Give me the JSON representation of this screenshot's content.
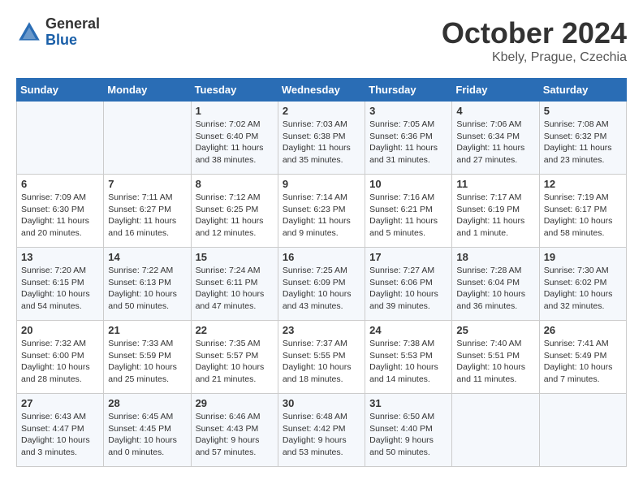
{
  "header": {
    "logo_general": "General",
    "logo_blue": "Blue",
    "month_title": "October 2024",
    "location": "Kbely, Prague, Czechia"
  },
  "days_of_week": [
    "Sunday",
    "Monday",
    "Tuesday",
    "Wednesday",
    "Thursday",
    "Friday",
    "Saturday"
  ],
  "weeks": [
    [
      {
        "day": "",
        "info": ""
      },
      {
        "day": "",
        "info": ""
      },
      {
        "day": "1",
        "info": "Sunrise: 7:02 AM\nSunset: 6:40 PM\nDaylight: 11 hours and 38 minutes."
      },
      {
        "day": "2",
        "info": "Sunrise: 7:03 AM\nSunset: 6:38 PM\nDaylight: 11 hours and 35 minutes."
      },
      {
        "day": "3",
        "info": "Sunrise: 7:05 AM\nSunset: 6:36 PM\nDaylight: 11 hours and 31 minutes."
      },
      {
        "day": "4",
        "info": "Sunrise: 7:06 AM\nSunset: 6:34 PM\nDaylight: 11 hours and 27 minutes."
      },
      {
        "day": "5",
        "info": "Sunrise: 7:08 AM\nSunset: 6:32 PM\nDaylight: 11 hours and 23 minutes."
      }
    ],
    [
      {
        "day": "6",
        "info": "Sunrise: 7:09 AM\nSunset: 6:30 PM\nDaylight: 11 hours and 20 minutes."
      },
      {
        "day": "7",
        "info": "Sunrise: 7:11 AM\nSunset: 6:27 PM\nDaylight: 11 hours and 16 minutes."
      },
      {
        "day": "8",
        "info": "Sunrise: 7:12 AM\nSunset: 6:25 PM\nDaylight: 11 hours and 12 minutes."
      },
      {
        "day": "9",
        "info": "Sunrise: 7:14 AM\nSunset: 6:23 PM\nDaylight: 11 hours and 9 minutes."
      },
      {
        "day": "10",
        "info": "Sunrise: 7:16 AM\nSunset: 6:21 PM\nDaylight: 11 hours and 5 minutes."
      },
      {
        "day": "11",
        "info": "Sunrise: 7:17 AM\nSunset: 6:19 PM\nDaylight: 11 hours and 1 minute."
      },
      {
        "day": "12",
        "info": "Sunrise: 7:19 AM\nSunset: 6:17 PM\nDaylight: 10 hours and 58 minutes."
      }
    ],
    [
      {
        "day": "13",
        "info": "Sunrise: 7:20 AM\nSunset: 6:15 PM\nDaylight: 10 hours and 54 minutes."
      },
      {
        "day": "14",
        "info": "Sunrise: 7:22 AM\nSunset: 6:13 PM\nDaylight: 10 hours and 50 minutes."
      },
      {
        "day": "15",
        "info": "Sunrise: 7:24 AM\nSunset: 6:11 PM\nDaylight: 10 hours and 47 minutes."
      },
      {
        "day": "16",
        "info": "Sunrise: 7:25 AM\nSunset: 6:09 PM\nDaylight: 10 hours and 43 minutes."
      },
      {
        "day": "17",
        "info": "Sunrise: 7:27 AM\nSunset: 6:06 PM\nDaylight: 10 hours and 39 minutes."
      },
      {
        "day": "18",
        "info": "Sunrise: 7:28 AM\nSunset: 6:04 PM\nDaylight: 10 hours and 36 minutes."
      },
      {
        "day": "19",
        "info": "Sunrise: 7:30 AM\nSunset: 6:02 PM\nDaylight: 10 hours and 32 minutes."
      }
    ],
    [
      {
        "day": "20",
        "info": "Sunrise: 7:32 AM\nSunset: 6:00 PM\nDaylight: 10 hours and 28 minutes."
      },
      {
        "day": "21",
        "info": "Sunrise: 7:33 AM\nSunset: 5:59 PM\nDaylight: 10 hours and 25 minutes."
      },
      {
        "day": "22",
        "info": "Sunrise: 7:35 AM\nSunset: 5:57 PM\nDaylight: 10 hours and 21 minutes."
      },
      {
        "day": "23",
        "info": "Sunrise: 7:37 AM\nSunset: 5:55 PM\nDaylight: 10 hours and 18 minutes."
      },
      {
        "day": "24",
        "info": "Sunrise: 7:38 AM\nSunset: 5:53 PM\nDaylight: 10 hours and 14 minutes."
      },
      {
        "day": "25",
        "info": "Sunrise: 7:40 AM\nSunset: 5:51 PM\nDaylight: 10 hours and 11 minutes."
      },
      {
        "day": "26",
        "info": "Sunrise: 7:41 AM\nSunset: 5:49 PM\nDaylight: 10 hours and 7 minutes."
      }
    ],
    [
      {
        "day": "27",
        "info": "Sunrise: 6:43 AM\nSunset: 4:47 PM\nDaylight: 10 hours and 3 minutes."
      },
      {
        "day": "28",
        "info": "Sunrise: 6:45 AM\nSunset: 4:45 PM\nDaylight: 10 hours and 0 minutes."
      },
      {
        "day": "29",
        "info": "Sunrise: 6:46 AM\nSunset: 4:43 PM\nDaylight: 9 hours and 57 minutes."
      },
      {
        "day": "30",
        "info": "Sunrise: 6:48 AM\nSunset: 4:42 PM\nDaylight: 9 hours and 53 minutes."
      },
      {
        "day": "31",
        "info": "Sunrise: 6:50 AM\nSunset: 4:40 PM\nDaylight: 9 hours and 50 minutes."
      },
      {
        "day": "",
        "info": ""
      },
      {
        "day": "",
        "info": ""
      }
    ]
  ]
}
